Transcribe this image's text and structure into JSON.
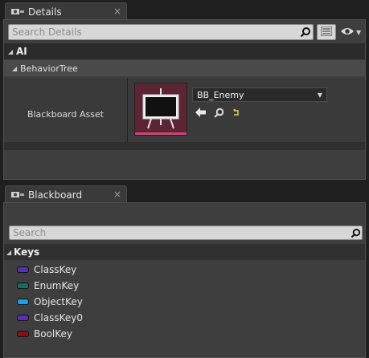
{
  "details": {
    "tab_label": "Details",
    "close_glyph": "×",
    "search_placeholder": "Search Details",
    "category": "AI",
    "subcategory": "BehaviorTree",
    "property_name": "Blackboard Asset",
    "asset_value": "BB_Enemy"
  },
  "blackboard": {
    "tab_label": "Blackboard",
    "close_glyph": "×",
    "search_placeholder": "Search",
    "keys_header": "Keys",
    "keys": [
      {
        "label": "ClassKey",
        "color": "#5a2fb0"
      },
      {
        "label": "EnumKey",
        "color": "#1a6f5a"
      },
      {
        "label": "ObjectKey",
        "color": "#1ea0d8"
      },
      {
        "label": "ClassKey0",
        "color": "#5a2fb0"
      },
      {
        "label": "BoolKey",
        "color": "#8a1010"
      }
    ]
  },
  "colors": {
    "thumbnail_bg": "#5b2534",
    "thumbnail_accent": "#d63e78",
    "panel_bg": "#3e3e3e",
    "category_bg": "#2b2b2b"
  }
}
